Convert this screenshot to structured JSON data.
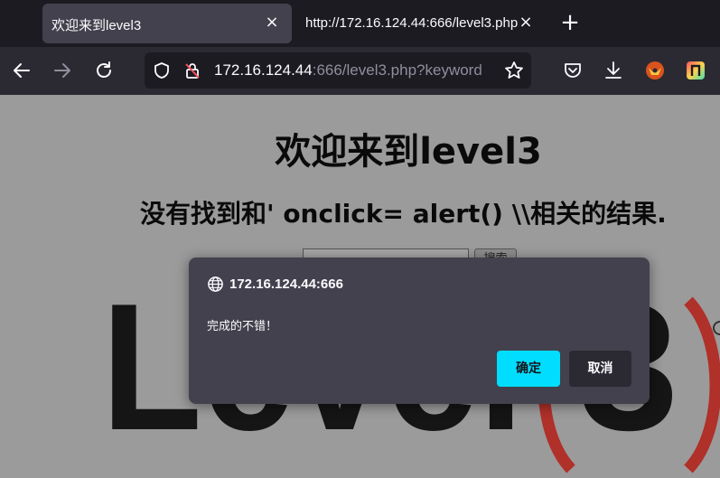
{
  "tabs": [
    {
      "title": "欢迎来到level3",
      "active": true
    },
    {
      "title": "http://172.16.124.44:666/level3.php?keyword",
      "active": false
    }
  ],
  "url": {
    "host": "172.16.124.44",
    "rest": ":666/level3.php?keyword"
  },
  "page": {
    "heading": "欢迎来到level3",
    "result": "没有找到和' onclick= alert() \\\\相关的结果.",
    "search_button": "搜索",
    "search_value": ""
  },
  "logo": {
    "text": "Level",
    "number": "3"
  },
  "dialog": {
    "origin": "172.16.124.44:666",
    "message": "完成的不错！",
    "ok_label": "确定",
    "cancel_label": "取消"
  },
  "colors": {
    "accent": "#00ddff",
    "dialog_bg": "#42414d",
    "toolbar_bg": "#2b2a33",
    "tabbar_bg": "#1c1b22",
    "logo_red": "#b0302a"
  }
}
